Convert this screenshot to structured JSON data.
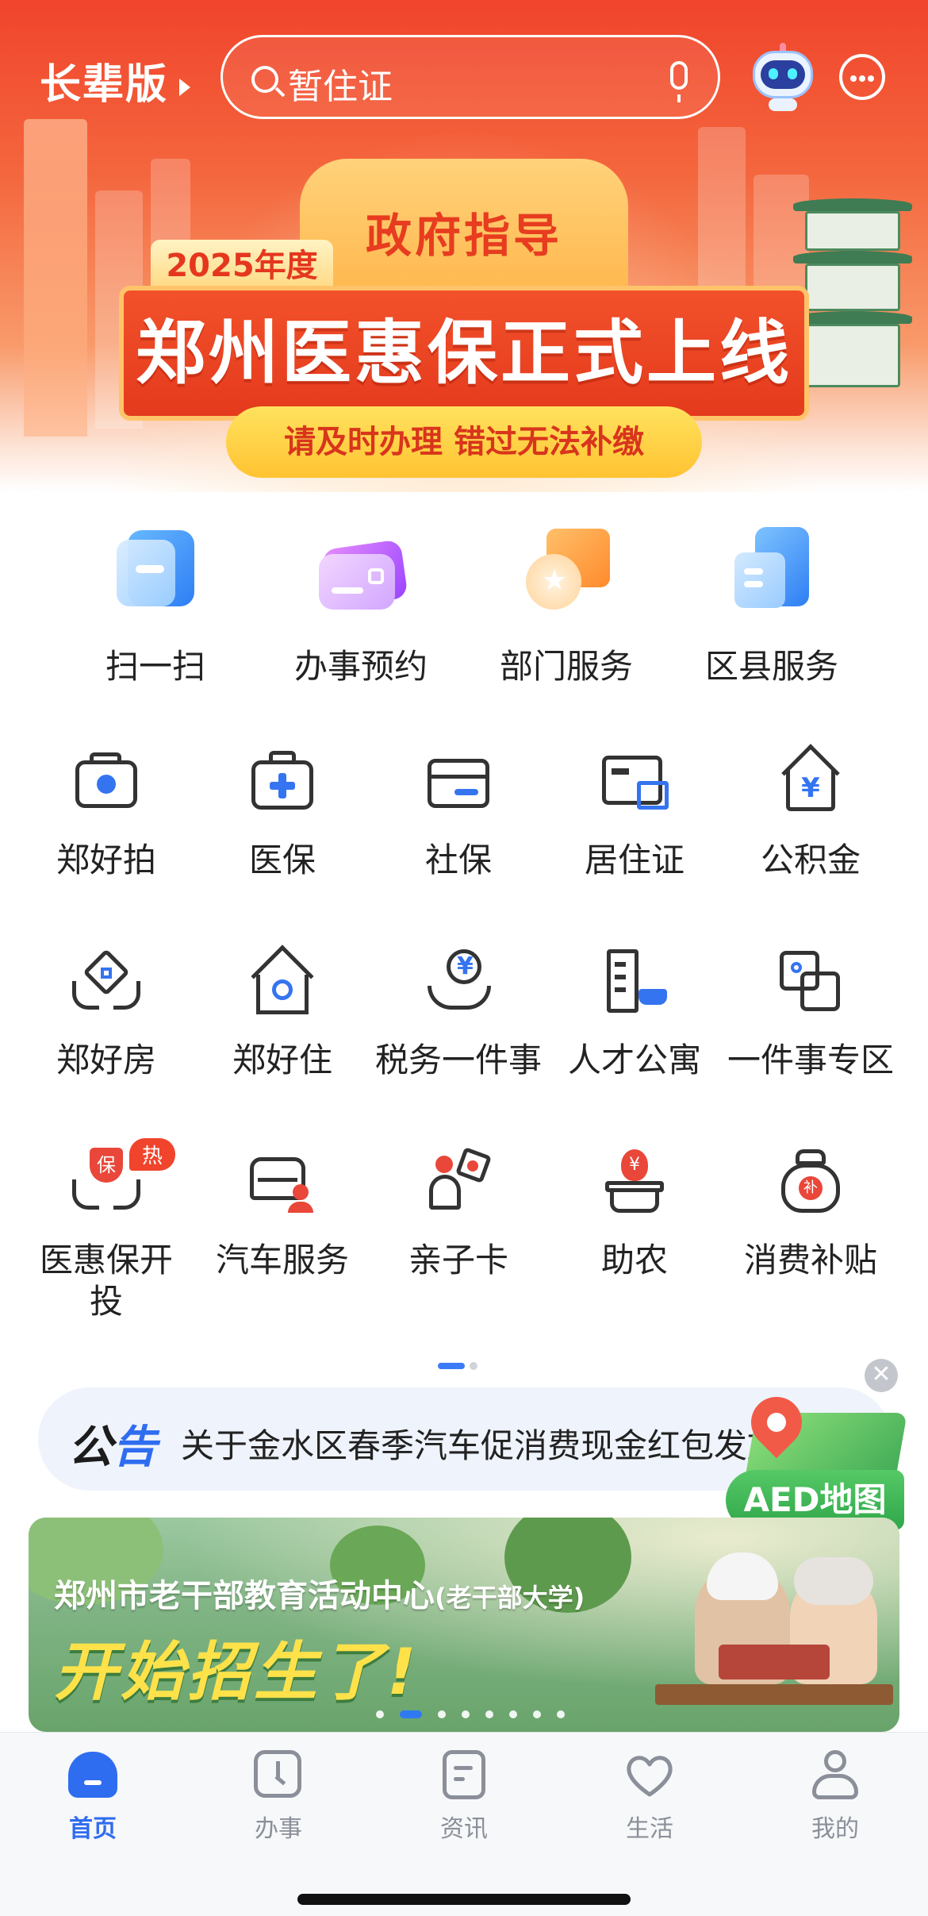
{
  "header": {
    "elder_label": "长辈版",
    "search_placeholder": "暂住证"
  },
  "hero_banner": {
    "guide": "政府指导",
    "year": "2025年度",
    "headline": "郑州医惠保正式上线",
    "sub": "请及时办理 错过无法补缴"
  },
  "quick_services": [
    {
      "label": "扫一扫",
      "icon": "scan-icon"
    },
    {
      "label": "办事预约",
      "icon": "appointment-card-icon"
    },
    {
      "label": "部门服务",
      "icon": "department-star-icon"
    },
    {
      "label": "区县服务",
      "icon": "county-building-icon"
    }
  ],
  "services": [
    {
      "label": "郑好拍",
      "icon": "camera-icon"
    },
    {
      "label": "医保",
      "icon": "medical-kit-icon"
    },
    {
      "label": "社保",
      "icon": "card-icon"
    },
    {
      "label": "居住证",
      "icon": "residence-card-icon"
    },
    {
      "label": "公积金",
      "icon": "housing-fund-icon"
    },
    {
      "label": "郑好房",
      "icon": "house-hands-icon"
    },
    {
      "label": "郑好住",
      "icon": "home-badge-icon"
    },
    {
      "label": "税务一件事",
      "icon": "tax-hand-icon"
    },
    {
      "label": "人才公寓",
      "icon": "talent-apartment-icon"
    },
    {
      "label": "一件事专区",
      "icon": "overlap-squares-icon"
    },
    {
      "label": "医惠保开投",
      "icon": "insurance-hands-icon",
      "badge": "热"
    },
    {
      "label": "汽车服务",
      "icon": "car-service-icon"
    },
    {
      "label": "亲子卡",
      "icon": "parent-child-icon"
    },
    {
      "label": "助农",
      "icon": "farm-basket-icon"
    },
    {
      "label": "消费补贴",
      "icon": "subsidy-bag-icon"
    }
  ],
  "notice": {
    "tag_a": "公",
    "tag_b": "告",
    "text": "关于金水区春季汽车促消费现金红包发放"
  },
  "aed": {
    "label": "AED地图"
  },
  "promo": {
    "line1": "郑州市老干部教育活动中心",
    "line1_note": "(老干部大学)",
    "line2": "开始招生了!",
    "dots_total": 8,
    "dots_active": 1
  },
  "tabs": [
    {
      "label": "首页",
      "icon": "home-icon",
      "active": true
    },
    {
      "label": "办事",
      "icon": "clock-icon",
      "active": false
    },
    {
      "label": "资讯",
      "icon": "news-icon",
      "active": false
    },
    {
      "label": "生活",
      "icon": "heart-icon",
      "active": false
    },
    {
      "label": "我的",
      "icon": "profile-icon",
      "active": false
    }
  ],
  "colors": {
    "accent": "#2f6df0",
    "hero_red": "#f0442c",
    "icon_blue": "#3574f0"
  }
}
